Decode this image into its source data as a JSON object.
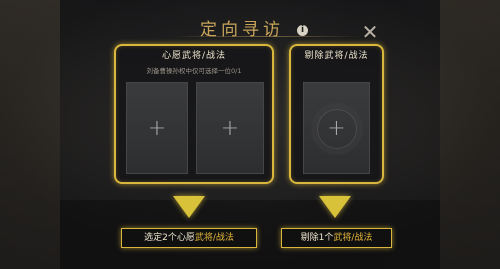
{
  "dialog": {
    "title": "定向寻访",
    "info_icon": "info-icon",
    "close_icon": "close-icon",
    "close_label": "✕"
  },
  "wish_panel": {
    "title": "心愿武将/战法",
    "subtitle": "刘备曹操孙权中仅可选择一位0/1",
    "slots": [
      {
        "icon": "plus-icon",
        "label": "+"
      },
      {
        "icon": "plus-icon",
        "label": "+"
      }
    ]
  },
  "exclude_panel": {
    "title": "剔除武将/战法",
    "slots": [
      {
        "icon": "plus-icon",
        "label": "+"
      }
    ]
  },
  "captions": {
    "left_prefix": "选定2个心愿",
    "left_highlight": "武将/战法",
    "right_prefix": "剔除1个",
    "right_highlight": "武将/战法"
  },
  "colors": {
    "accent_gold": "#d9b73e",
    "title_gold": "#c9a55a",
    "highlight": "#e5b83a"
  }
}
